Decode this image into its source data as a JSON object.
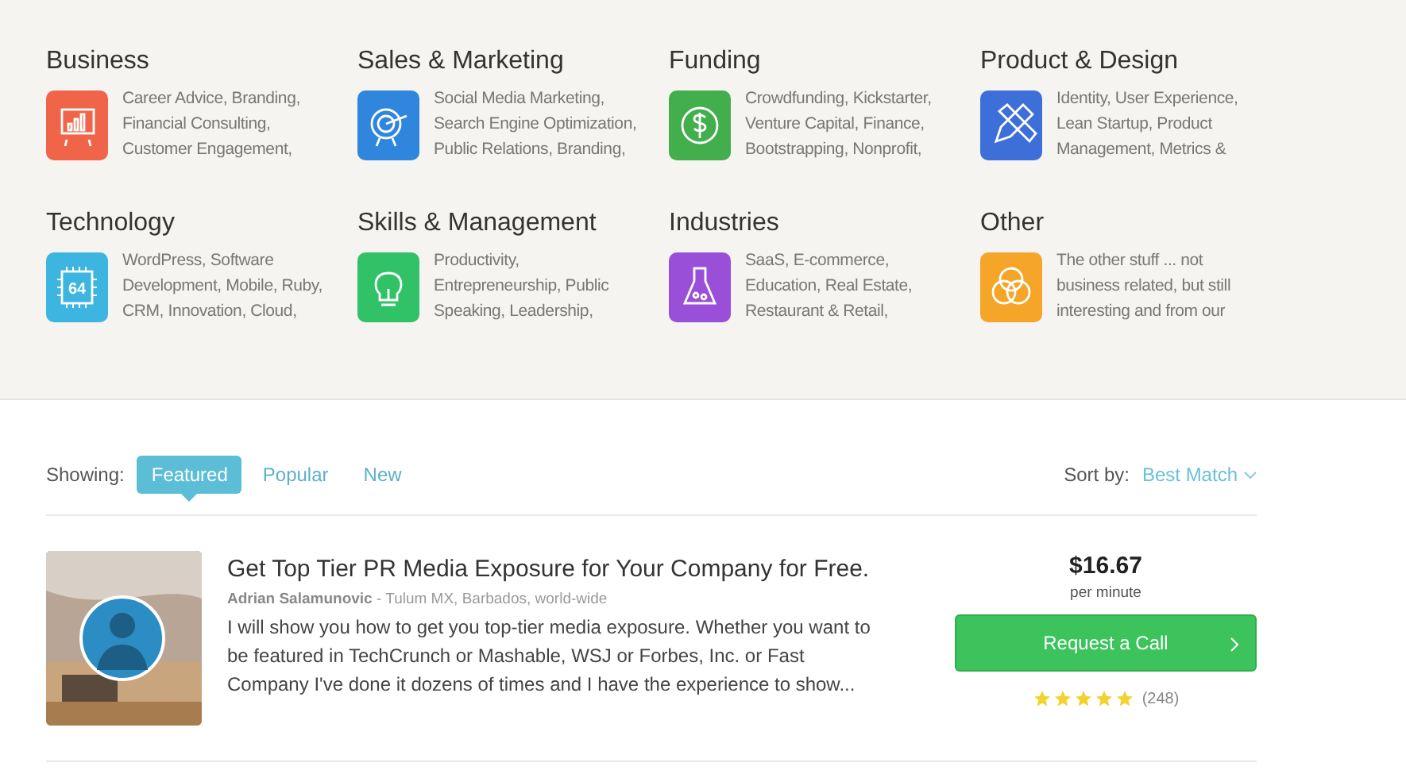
{
  "categories": [
    {
      "title": "Business",
      "description": "Career Advice, Branding, Financial Consulting, Customer Engagement,",
      "kind": "chart",
      "color": "#f0654a"
    },
    {
      "title": "Sales & Marketing",
      "description": "Social Media Marketing, Search Engine Optimization, Public Relations, Branding,",
      "kind": "target",
      "color": "#2f86dc"
    },
    {
      "title": "Funding",
      "description": "Crowdfunding, Kickstarter, Venture Capital, Finance, Bootstrapping, Nonprofit,",
      "kind": "dollar",
      "color": "#43ae4c"
    },
    {
      "title": "Product & Design",
      "description": "Identity, User Experience, Lean Startup, Product Management, Metrics &",
      "kind": "tools",
      "color": "#3e6fd8"
    },
    {
      "title": "Technology",
      "description": "WordPress, Software Development, Mobile, Ruby, CRM, Innovation, Cloud,",
      "kind": "chip",
      "color": "#3cb5e0",
      "icon_text": "64"
    },
    {
      "title": "Skills & Management",
      "description": "Productivity, Entrepreneurship, Public Speaking, Leadership,",
      "kind": "bulb",
      "color": "#31c267"
    },
    {
      "title": "Industries",
      "description": "SaaS, E-commerce, Education, Real Estate, Restaurant & Retail,",
      "kind": "flask",
      "color": "#9a4fd8"
    },
    {
      "title": "Other",
      "description": "The other stuff ... not business related, but still interesting and from our",
      "kind": "circles",
      "color": "#f5a528"
    }
  ],
  "filter": {
    "label": "Showing:",
    "tabs": [
      {
        "label": "Featured",
        "selected": true
      },
      {
        "label": "Popular",
        "selected": false
      },
      {
        "label": "New",
        "selected": false
      }
    ]
  },
  "sort": {
    "label": "Sort by:",
    "value": "Best Match"
  },
  "listings": [
    {
      "title": "Get Top Tier PR Media Exposure for Your Company for Free.",
      "author": "Adrian Salamunovic",
      "location": "- Tulum MX, Barbados, world-wide",
      "description": "I will show you how to get you top-tier media exposure. Whether you want to be featured in TechCrunch or Mashable, WSJ or Forbes, Inc. or Fast Company I've done it dozens of times and I have the experience to show...",
      "price": "$16.67",
      "price_unit": "per minute",
      "button": "Request a Call",
      "stars": 5,
      "reviews": "(248)"
    }
  ]
}
